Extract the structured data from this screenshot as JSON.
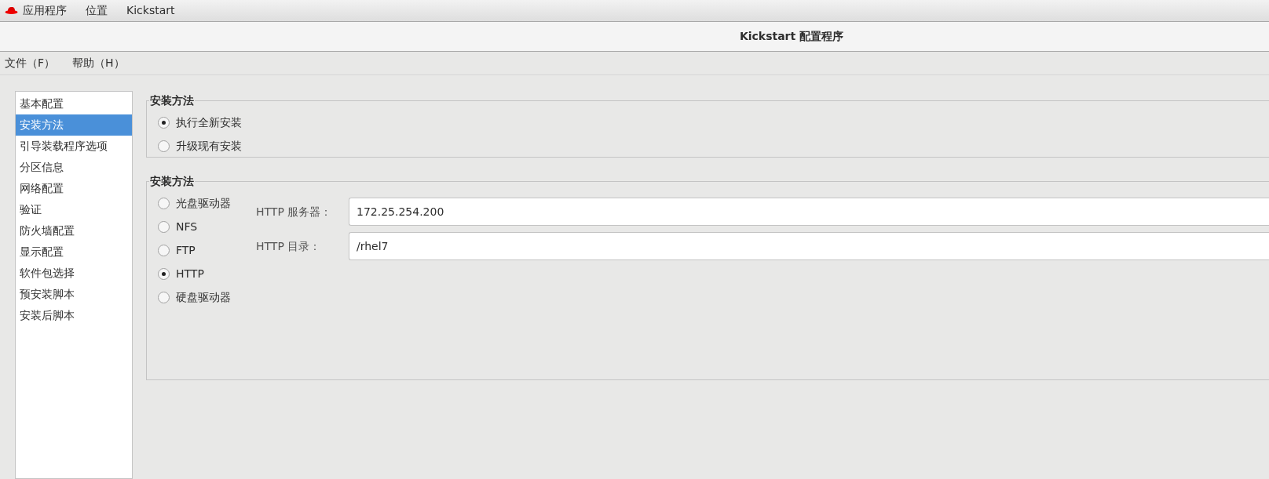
{
  "top_bar": {
    "items": [
      "应用程序",
      "位置",
      "Kickstart"
    ]
  },
  "window": {
    "title": "Kickstart 配置程序"
  },
  "menu": [
    "文件（F）",
    "帮助（H）"
  ],
  "sidebar": {
    "items": [
      {
        "label": "基本配置",
        "selected": false
      },
      {
        "label": "安装方法",
        "selected": true
      },
      {
        "label": "引导装载程序选项",
        "selected": false
      },
      {
        "label": "分区信息",
        "selected": false
      },
      {
        "label": "网络配置",
        "selected": false
      },
      {
        "label": "验证",
        "selected": false
      },
      {
        "label": "防火墙配置",
        "selected": false
      },
      {
        "label": "显示配置",
        "selected": false
      },
      {
        "label": "软件包选择",
        "selected": false
      },
      {
        "label": "预安装脚本",
        "selected": false
      },
      {
        "label": "安装后脚本",
        "selected": false
      }
    ]
  },
  "install_type": {
    "title": "安装方法",
    "options": [
      {
        "label": "执行全新安装",
        "selected": true
      },
      {
        "label": "升级现有安装",
        "selected": false
      }
    ]
  },
  "install_method": {
    "title": "安装方法",
    "options": [
      {
        "label": "光盘驱动器",
        "selected": false
      },
      {
        "label": "NFS",
        "selected": false
      },
      {
        "label": "FTP",
        "selected": false
      },
      {
        "label": "HTTP",
        "selected": true
      },
      {
        "label": "硬盘驱动器",
        "selected": false
      }
    ],
    "fields": [
      {
        "label": "HTTP 服务器：",
        "value": "172.25.254.200"
      },
      {
        "label": "HTTP 目录：",
        "value": "/rhel7"
      }
    ]
  }
}
